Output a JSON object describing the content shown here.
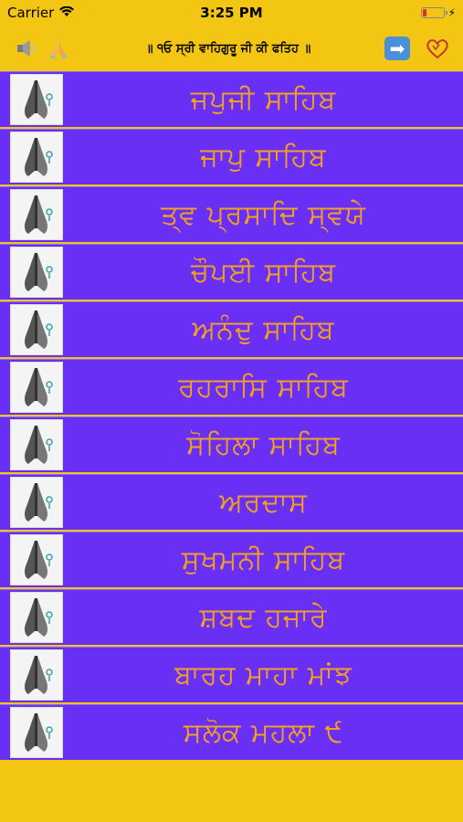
{
  "status": {
    "carrier": "Carrier",
    "time": "3:25 PM"
  },
  "header": {
    "title": "॥ ੧ਓ ਸ੍ਰੀ ਵਾਹਿਗੁਰੂ ਜੀ ਕੀ ਫਤਿਹ ॥",
    "left_icons": [
      "speaker-icon",
      "praying-hands-icon"
    ],
    "right_icons": [
      "right-arrow-icon",
      "heart-outline-icon"
    ],
    "arrow_glyph": "➡"
  },
  "items": [
    {
      "label": "ਜਪੁਜੀ ਸਾਹਿਬ"
    },
    {
      "label": "ਜਾਪੁ ਸਾਹਿਬ"
    },
    {
      "label": "ਤ੍ਵ ਪ੍ਰਸਾਦਿ ਸ੍ਵਯੇ"
    },
    {
      "label": "ਚੌਪਈ ਸਾਹਿਬ"
    },
    {
      "label": "ਅਨੰਦੁ ਸਾਹਿਬ"
    },
    {
      "label": "ਰਹਰਾਸਿ ਸਾਹਿਬ"
    },
    {
      "label": "ਸੋਹਿਲਾ ਸਾਹਿਬ"
    },
    {
      "label": "ਅਰਦਾਸ"
    },
    {
      "label": "ਸੁਖਮਨੀ ਸਾਹਿਬ"
    },
    {
      "label": "ਸ਼ਬਦ  ਹਜਾਰੇ"
    },
    {
      "label": "ਬਾਰਹ ਮਾਹਾ ਮਾਂਝ"
    },
    {
      "label": "ਸਲੋਕ ਮਹਲਾ ੯"
    }
  ],
  "colors": {
    "background": "#f3c614",
    "row": "#6a2ff5",
    "label": "#f3a01e"
  }
}
